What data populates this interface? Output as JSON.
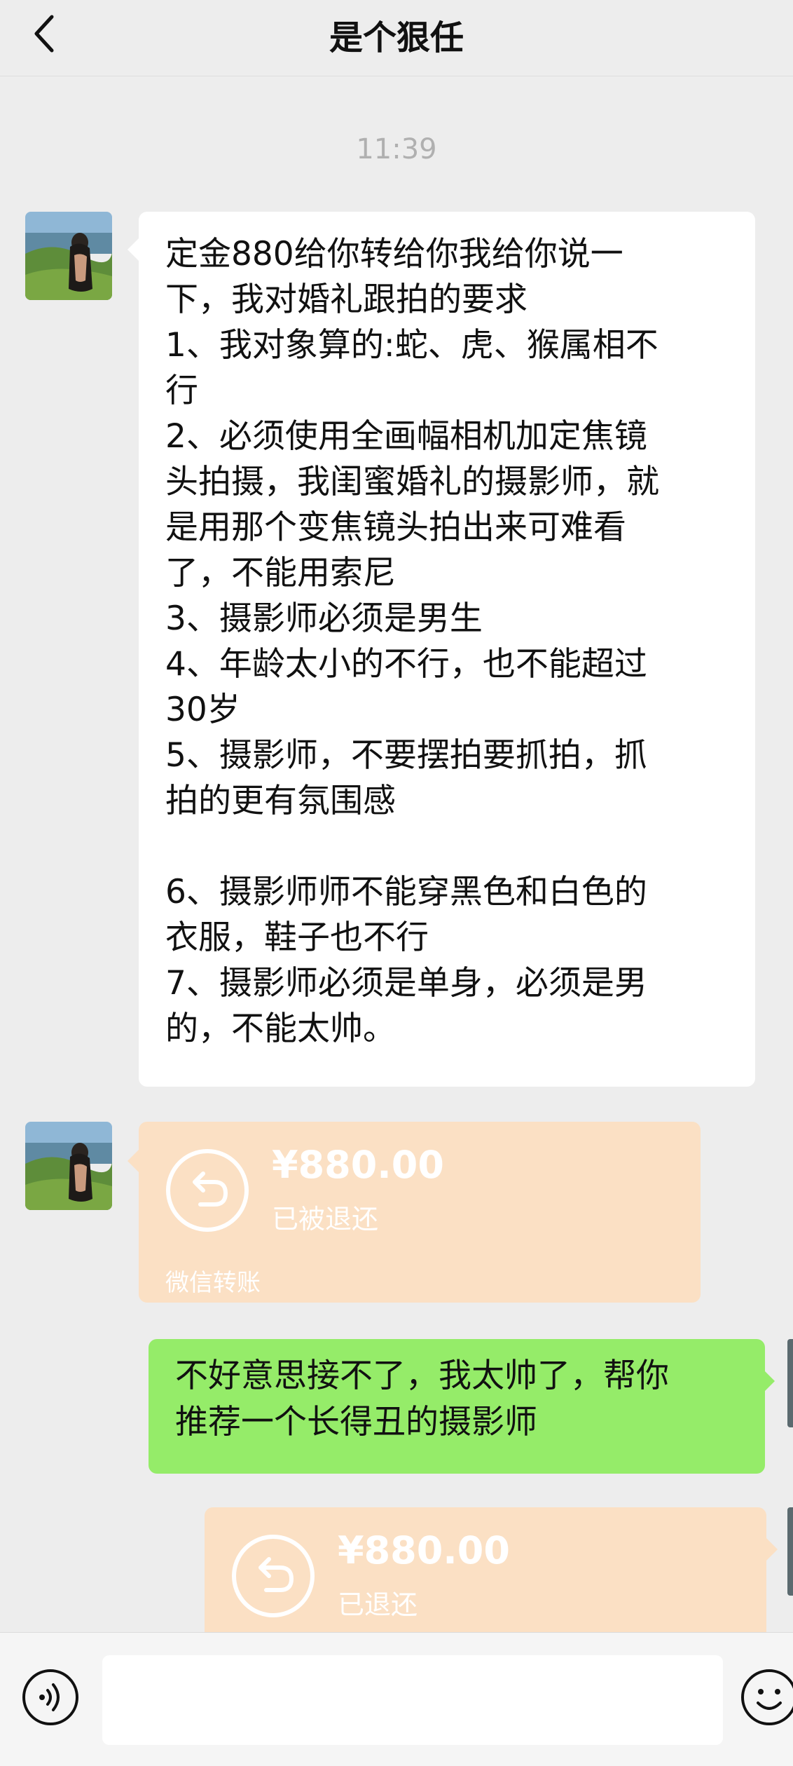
{
  "header": {
    "title": "是个狠任"
  },
  "chat": {
    "time": "11:39",
    "messages": [
      {
        "side": "left",
        "text": "定金880给你转给你我给你说一\n下，我对婚礼跟拍的要求\n1、我对象算的:蛇、虎、猴属相不\n行\n2、必须使用全画幅相机加定焦镜\n头拍摄，我闺蜜婚礼的摄影师，就\n是用那个变焦镜头拍出来可难看\n了，不能用索尼\n3、摄影师必须是男生\n4、年龄太小的不行，也不能超过\n30岁\n5、摄影师，不要摆拍要抓拍，抓\n拍的更有氛围感\n\n6、摄影师师不能穿黑色和白色的\n衣服，鞋子也不行\n7、摄影师必须是单身，必须是男\n的，不能太帅。"
      },
      {
        "side": "left",
        "type": "transfer",
        "amount": "¥880.00",
        "status": "已被退还",
        "footer": "微信转账"
      },
      {
        "side": "right",
        "text": "不好意思接不了，我太帅了，帮你\n推荐一个长得丑的摄影师"
      },
      {
        "side": "right",
        "type": "transfer",
        "amount": "¥880.00",
        "status": "已退还"
      }
    ]
  },
  "colors": {
    "background": "#ededed",
    "bubble_white": "#ffffff",
    "bubble_green": "#95ec69",
    "transfer_returned": "#fbe0c4"
  },
  "icons": {
    "back": "chevron-left-icon",
    "transfer": "return-arrow-icon",
    "voice": "voice-icon",
    "emoji": "emoji-icon"
  }
}
